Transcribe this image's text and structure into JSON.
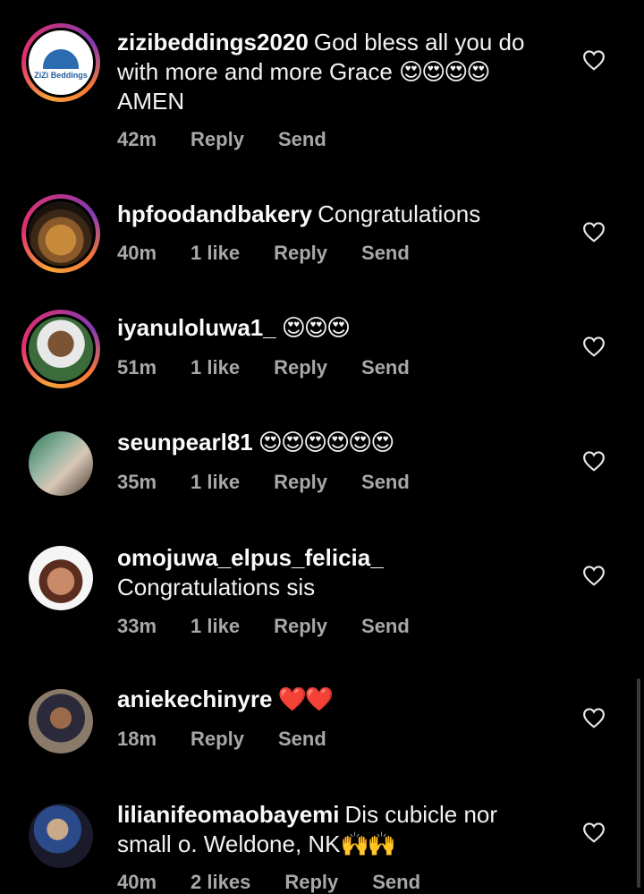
{
  "comments": [
    {
      "username": "zizibeddings2020",
      "text": "God bless all you do with more and more Grace",
      "emoji": "😍😍😍😍",
      "text2": "AMEN",
      "time": "42m",
      "likes": "",
      "reply": "Reply",
      "send": "Send",
      "avatar": "zizi-beddings-logo",
      "logo_text": "ZiZi Beddings"
    },
    {
      "username": "hpfoodandbakery",
      "text": "Congratulations",
      "emoji": "",
      "time": "40m",
      "likes": "1 like",
      "reply": "Reply",
      "send": "Send",
      "avatar": "food-photo"
    },
    {
      "username": "iyanuloluwa1_",
      "text": "",
      "emoji": "😍😍😍",
      "time": "51m",
      "likes": "1 like",
      "reply": "Reply",
      "send": "Send",
      "avatar": "person-photo"
    },
    {
      "username": "seunpearl81",
      "text": "",
      "emoji": "😍😍😍😍😍😍",
      "time": "35m",
      "likes": "1 like",
      "reply": "Reply",
      "send": "Send",
      "avatar": "person-photo"
    },
    {
      "username": "omojuwa_elpus_felicia_",
      "text": "Congratulations sis",
      "emoji": "",
      "time": "33m",
      "likes": "1 like",
      "reply": "Reply",
      "send": "Send",
      "avatar": "person-photo"
    },
    {
      "username": "aniekechinyre",
      "text": "",
      "emoji": "❤️❤️",
      "time": "18m",
      "likes": "",
      "reply": "Reply",
      "send": "Send",
      "avatar": "person-photo"
    },
    {
      "username": "lilianifeomaobayemi",
      "text": "Dis cubicle nor small o. Weldone, NK",
      "emoji": "🙌🙌",
      "time": "40m",
      "likes": "2 likes",
      "reply": "Reply",
      "send": "Send",
      "avatar": "person-photo"
    }
  ],
  "colors": {
    "background": "#000000",
    "meta": "#a8a8a8",
    "text": "#f2f2f2"
  }
}
